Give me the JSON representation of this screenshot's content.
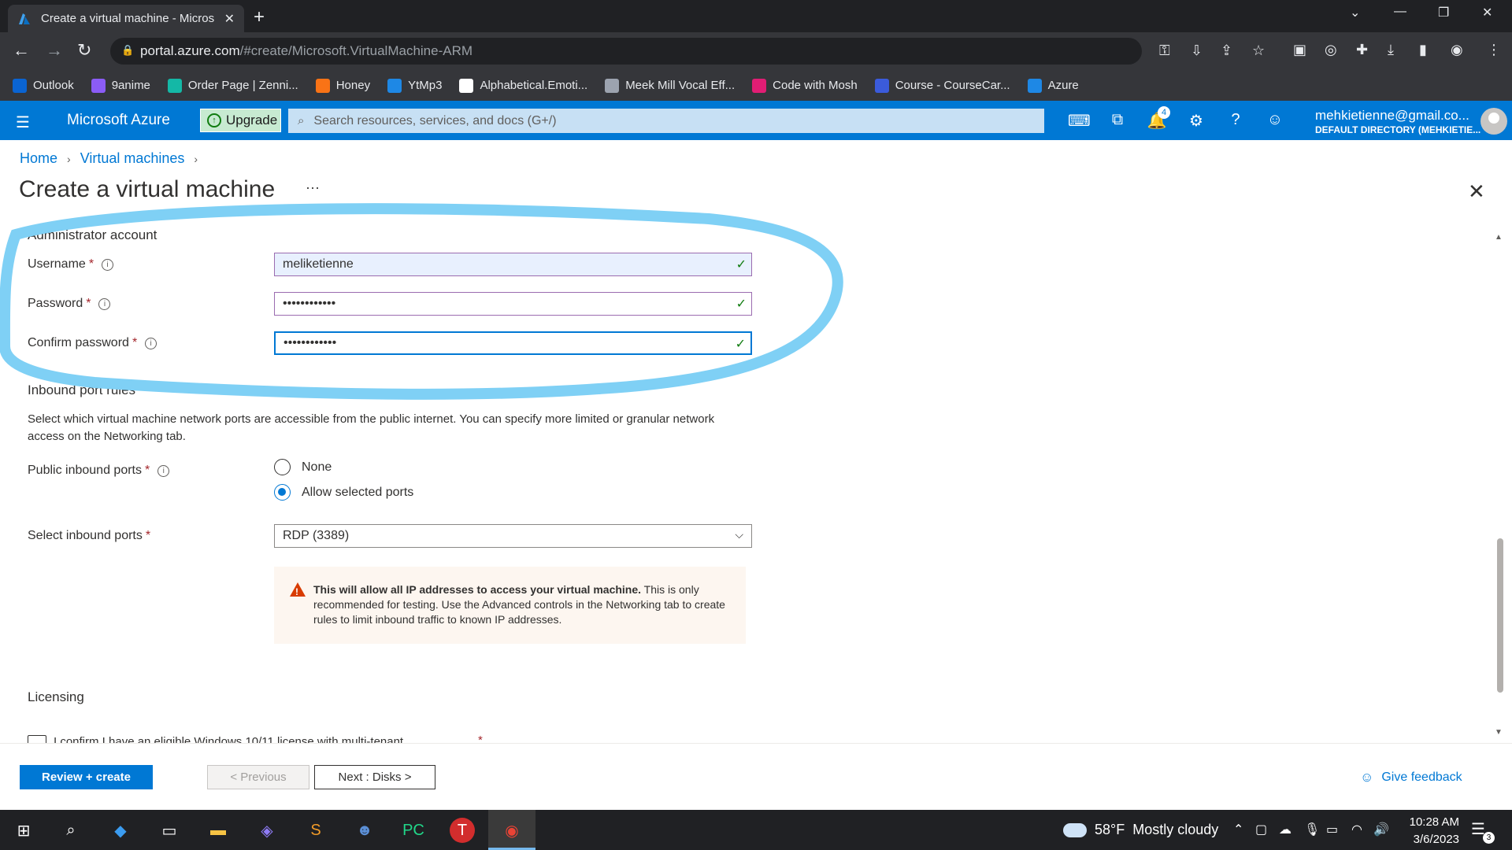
{
  "browser": {
    "tab_title": "Create a virtual machine - Micros",
    "url_host": "portal.azure.com",
    "url_path": "/#create/Microsoft.VirtualMachine-ARM",
    "bookmarks": [
      {
        "label": "Outlook",
        "color": "#0a64d2"
      },
      {
        "label": "9anime",
        "color": "#8b5cf6"
      },
      {
        "label": "Order Page | Zenni...",
        "color": "#14b8a6"
      },
      {
        "label": "Honey",
        "color": "#f97316"
      },
      {
        "label": "YtMp3",
        "color": "#1e88e5"
      },
      {
        "label": "Alphabetical.Emoti...",
        "color": "#ffffff"
      },
      {
        "label": "Meek Mill Vocal Eff...",
        "color": "#9ca3af"
      },
      {
        "label": "Code with Mosh",
        "color": "#e11d74"
      },
      {
        "label": "Course - CourseCar...",
        "color": "#3b5bdb"
      },
      {
        "label": "Azure",
        "color": "#1e88e5"
      }
    ]
  },
  "azure_header": {
    "brand": "Microsoft Azure",
    "upgrade_label": "Upgrade",
    "search_placeholder": "Search resources, services, and docs (G+/)",
    "notification_count": "4",
    "account_email": "mehkietienne@gmail.co...",
    "account_directory": "DEFAULT DIRECTORY (MEHKIETIE..."
  },
  "breadcrumb": {
    "items": [
      "Home",
      "Virtual machines"
    ]
  },
  "page": {
    "title": "Create a virtual machine",
    "more": "···"
  },
  "admin_account": {
    "section_title": "Administrator account",
    "username_label": "Username",
    "username_value": "meliketienne",
    "password_label": "Password",
    "password_value": "••••••••••••",
    "confirm_label": "Confirm password",
    "confirm_value": "••••••••••••"
  },
  "inbound": {
    "section_title": "Inbound port rules",
    "description": "Select which virtual machine network ports are accessible from the public internet. You can specify more limited or granular network access on the Networking tab.",
    "public_ports_label": "Public inbound ports",
    "option_none": "None",
    "option_allow": "Allow selected ports",
    "selected_option": "Allow selected ports",
    "select_ports_label": "Select inbound ports",
    "select_ports_value": "RDP (3389)",
    "warning_bold": "This will allow all IP addresses to access your virtual machine.",
    "warning_text": " This is only recommended for testing.  Use the Advanced controls in the Networking tab to create rules to limit inbound traffic to known IP addresses."
  },
  "licensing": {
    "section_title": "Licensing",
    "confirm_text": "I confirm I have an eligible Windows 10/11 license with multi-tenant"
  },
  "footer": {
    "review_create": "Review + create",
    "previous": "< Previous",
    "next": "Next : Disks >",
    "feedback": "Give feedback"
  },
  "taskbar": {
    "temperature": "58°F",
    "weather": "Mostly cloudy",
    "time": "10:28 AM",
    "date": "3/6/2023",
    "notification_count": "3"
  },
  "colors": {
    "azure_blue": "#0078d4",
    "highlight": "#7fd0f5",
    "success": "#107c10",
    "warning": "#d83b01"
  }
}
